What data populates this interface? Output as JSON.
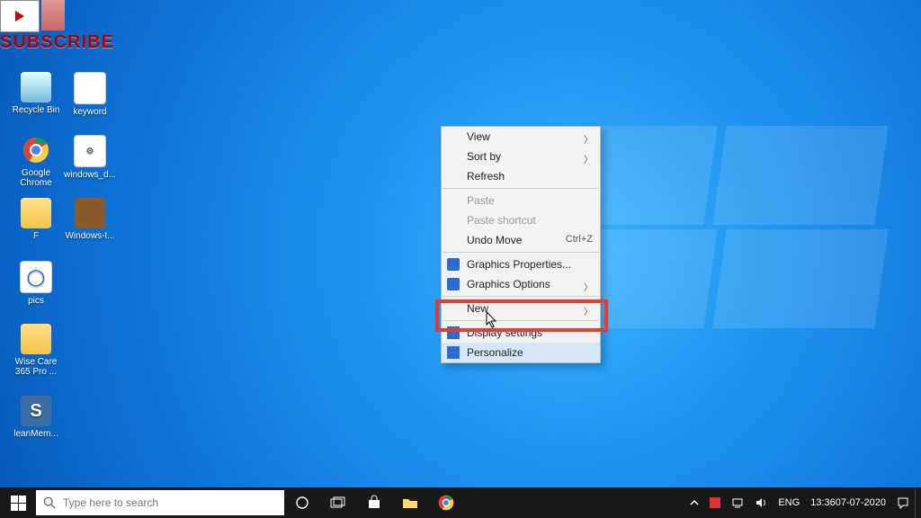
{
  "subscribe_text": "SUBSCRIBE",
  "desktop_icons": [
    {
      "label": "Recycle Bin"
    },
    {
      "label": "keyword"
    },
    {
      "label": "Google Chrome"
    },
    {
      "label": "windows_d..."
    },
    {
      "label": "F"
    },
    {
      "label": "Windows-I..."
    },
    {
      "label": "pics"
    },
    {
      "label": "Wise Care 365 Pro ..."
    },
    {
      "label": "leanMem..."
    }
  ],
  "context_menu": {
    "view": "View",
    "sort_by": "Sort by",
    "refresh": "Refresh",
    "paste": "Paste",
    "paste_shortcut": "Paste shortcut",
    "undo_move": "Undo Move",
    "undo_hint": "Ctrl+Z",
    "gfx_props": "Graphics Properties...",
    "gfx_opts": "Graphics Options",
    "new": "New",
    "display": "Display settings",
    "personalize": "Personalize"
  },
  "taskbar": {
    "search_placeholder": "Type here to search",
    "lang": "ENG",
    "time": "13:36",
    "date": "07-07-2020"
  }
}
